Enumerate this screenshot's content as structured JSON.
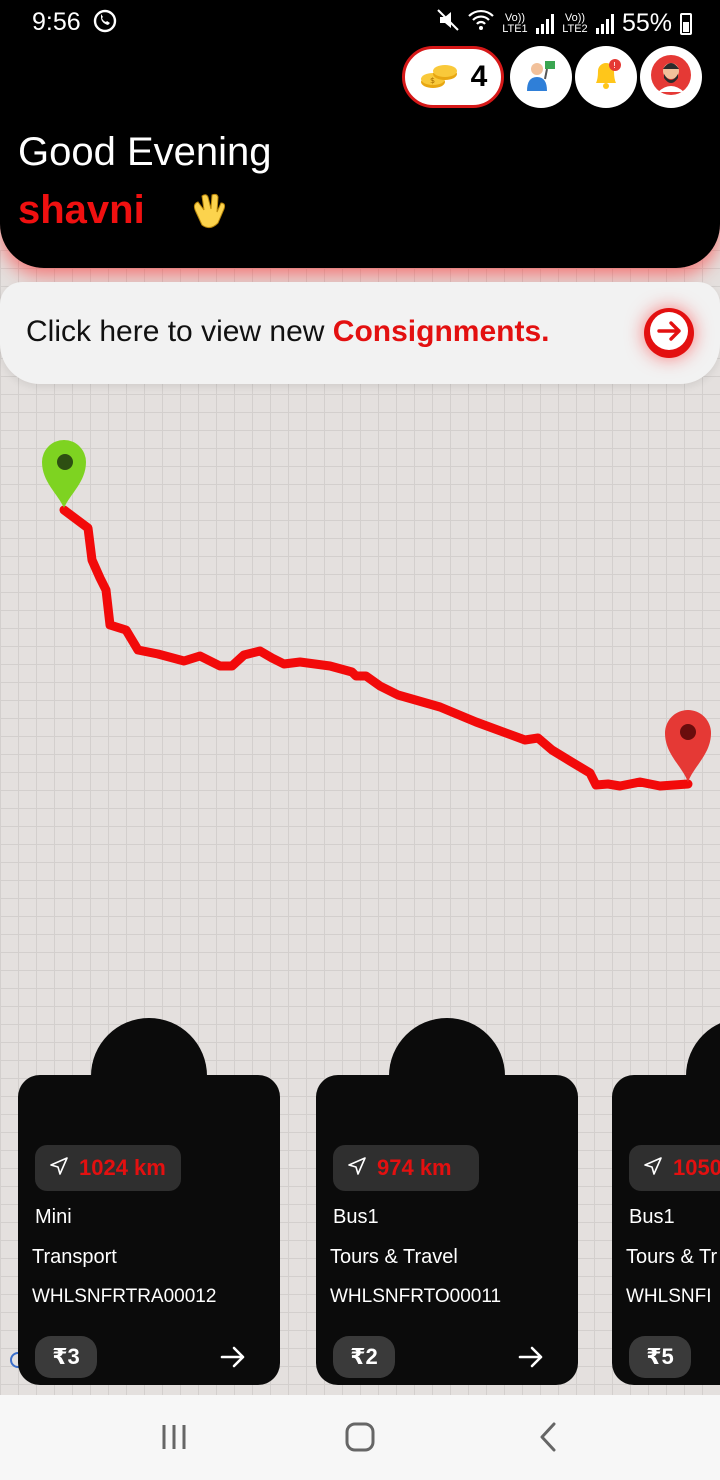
{
  "status_bar": {
    "time": "9:56",
    "sim1_label": "Vo)) LTE1",
    "sim2_label": "Vo)) LTE2",
    "battery": "55%"
  },
  "header": {
    "coins_count": "4",
    "greeting": "Good Evening",
    "username": "shavni"
  },
  "banner": {
    "text_prefix": "Click here to view new ",
    "text_highlight": "Consignments."
  },
  "cards": [
    {
      "distance": "1024 km",
      "vehicle": "Mini",
      "category": "Transport",
      "code": "WHLSNFRTRA00012",
      "price": "₹3"
    },
    {
      "distance": "974 km",
      "vehicle": "Bus1",
      "category": "Tours & Travel",
      "code": "WHLSNFRTO00011",
      "price": "₹2"
    },
    {
      "distance": "1050",
      "vehicle": "Bus1",
      "category": "Tours & Tr",
      "code": "WHLSNFI",
      "price": "₹5"
    }
  ],
  "colors": {
    "accent": "#e31010",
    "route": "#f20a0a",
    "start_pin": "#7ed321",
    "end_pin": "#e53935"
  }
}
